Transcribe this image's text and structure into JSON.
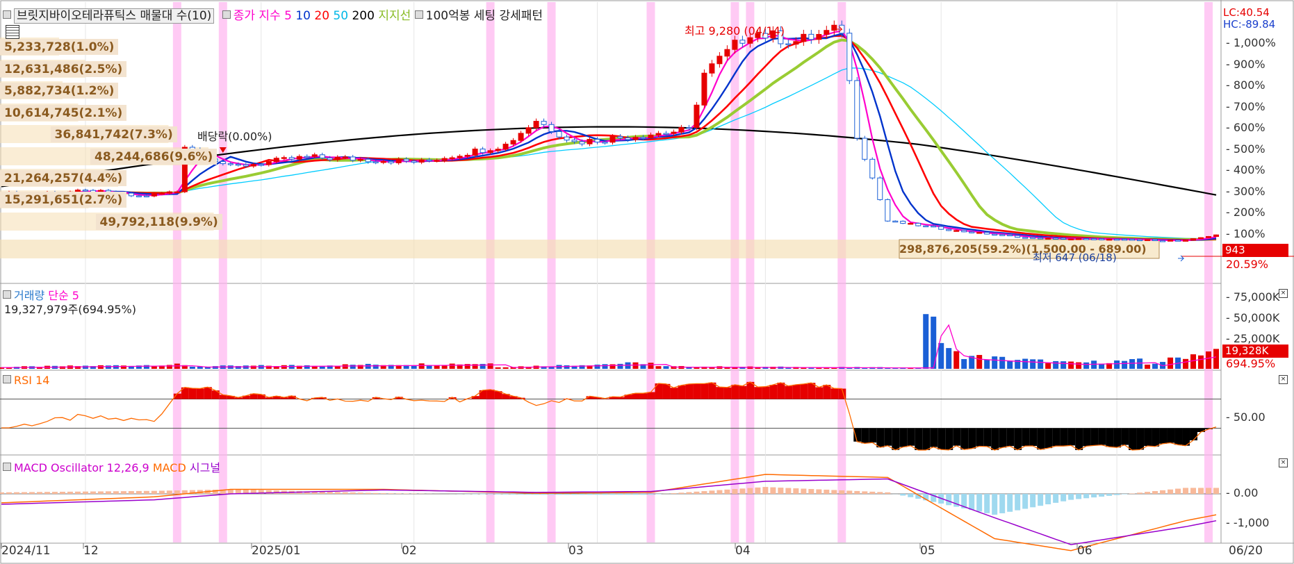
{
  "colors": {
    "ma5": "#ff00cc",
    "ma10": "#0033cc",
    "ma20": "#ff0000",
    "ma50": "#00ccff",
    "ma200": "#000000",
    "support": "#99cc33",
    "up": "#e60000",
    "down": "#1a5fd6",
    "rsi": "#ff6a00",
    "macd_osc": "#cc00cc",
    "macd": "#ff6a00",
    "signal": "#9900cc",
    "highlight": "#ffb3f0",
    "vp_fill": "#f5deb3"
  },
  "header": {
    "title": "브릿지바이오테라퓨틱스 매물대 수(10)",
    "ma_label": "종가 지수",
    "ma_periods": [
      "5",
      "10",
      "20",
      "50",
      "200"
    ],
    "support_label": "지지선",
    "setting": "100억봉 세팅 강세패턴"
  },
  "price_panel": {
    "lc": "LC:40.54",
    "hc": "HC:-89.84",
    "high_note": "최고 9,280 (04/14)",
    "low_note": "최저 647 (06/18)",
    "ex_dividend": "배당락(0.00%)",
    "current_price": "943",
    "current_pct": "20.59%",
    "y_ticks": [
      "1,000%",
      "900%",
      "800%",
      "700%",
      "600%",
      "500%",
      "400%",
      "300%",
      "200%",
      "100%"
    ],
    "volume_profile": [
      {
        "label": "5,233,728(1.0%)",
        "share": 1.0
      },
      {
        "label": "12,631,486(2.5%)",
        "share": 2.5
      },
      {
        "label": "5,882,734(1.2%)",
        "share": 1.2
      },
      {
        "label": "10,614,745(2.1%)",
        "share": 2.1
      },
      {
        "label": "36,841,742(7.3%)",
        "share": 7.3
      },
      {
        "label": "48,244,686(9.6%)",
        "share": 9.6
      },
      {
        "label": "21,264,257(4.4%)",
        "share": 4.4
      },
      {
        "label": "15,291,651(2.7%)",
        "share": 2.7
      },
      {
        "label": "49,792,118(9.9%)",
        "share": 9.9
      },
      {
        "label": "298,876,205(59.2%)(1,500.00 - 689.00)",
        "share": 59.2
      }
    ]
  },
  "volume_panel": {
    "title": "거래량",
    "ma_label": "단순 5",
    "current": "19,327,979주(694.95%)",
    "current_tag": "19,328K",
    "current_pct": "694.95%",
    "y_ticks": [
      "75,000K",
      "50,000K",
      "25,000K"
    ]
  },
  "rsi_panel": {
    "title": "RSI 14",
    "y_ticks": [
      "50.00"
    ]
  },
  "macd_panel": {
    "title": "MACD Oscillator 12,26,9",
    "macd_label": "MACD",
    "signal_label": "시그널",
    "y_ticks": [
      "0.00",
      "-1,000"
    ]
  },
  "x_axis": {
    "labels": [
      "2024/11",
      "12",
      "2025/01",
      "02",
      "03",
      "04",
      "05",
      "06",
      "06/20"
    ]
  },
  "chart_data": {
    "type": "candlestick",
    "title": "브릿지바이오테라퓨틱스",
    "x_labels": [
      "2024/11",
      "12",
      "2025/01",
      "02",
      "03",
      "04",
      "05",
      "06",
      "06/20"
    ],
    "price_axis_unit": "%",
    "price_y_ticks": [
      1000,
      900,
      800,
      700,
      600,
      500,
      400,
      300,
      200,
      100
    ],
    "high": {
      "value": 9280,
      "date": "04/14"
    },
    "low": {
      "value": 647,
      "date": "06/18"
    },
    "current_price": 943,
    "current_change_pct": 20.59,
    "highlight_dates": [
      "12/11",
      "12/18",
      "02/12",
      "02/24",
      "03/11",
      "03/25",
      "03/31",
      "04/11",
      "06/19"
    ],
    "volume_y_ticks_k": [
      75000,
      50000,
      25000
    ],
    "current_volume": 19327979,
    "rsi_y_ticks": [
      50
    ],
    "macd_y_ticks": [
      0,
      -1000
    ]
  }
}
